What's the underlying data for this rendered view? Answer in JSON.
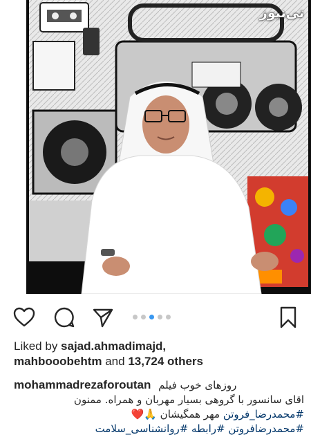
{
  "watermark": "تی‌نیوز",
  "carousel": {
    "count": 5,
    "active_index": 2
  },
  "likes": {
    "prefix": "Liked by ",
    "user1": "sajad.ahmadimajd,",
    "user2": "mahbooobehtm",
    "connector": " and ",
    "count_text": "13,724 others"
  },
  "caption": {
    "username": "mohammadrezaforoutan",
    "line1": "روزهای خوب فیلم",
    "line2": "اقای سانسور با گروهی بسیار مهربان و همراه. ممنون",
    "line3_text": "مهر همگیشان 🙏❤️",
    "line3_tag": "#محمدرضا_فروتن",
    "line4": "#محمدرضافروتن #رابطه #روانشناسی_سلامت"
  },
  "colors": {
    "accent_blue": "#3897f0",
    "hashtag": "#003569",
    "text": "#262626"
  },
  "icons": [
    "heart-icon",
    "comment-icon",
    "share-icon",
    "bookmark-icon"
  ]
}
